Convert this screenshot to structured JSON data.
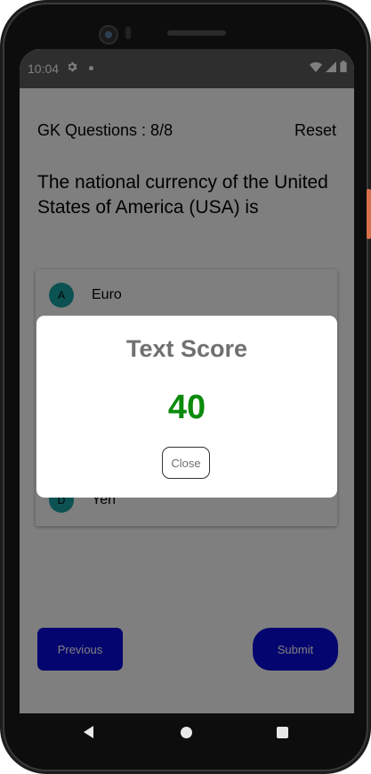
{
  "status_bar": {
    "time": "10:04",
    "icons": [
      "gear-icon",
      "notification-dot-icon",
      "wifi-icon",
      "cellular-signal-icon",
      "battery-icon"
    ]
  },
  "quiz": {
    "counter": "GK Questions : 8/8",
    "reset_label": "Reset",
    "question": "The national currency of the United States of America (USA) is",
    "options": [
      {
        "letter": "A",
        "label": "Euro"
      },
      {
        "letter": "D",
        "label": "Yen"
      }
    ],
    "previous_label": "Previous",
    "submit_label": "Submit"
  },
  "dialog": {
    "title": "Text Score",
    "score": "40",
    "close_label": "Close"
  },
  "colors": {
    "primary_button": "#0a0adf",
    "option_badge": "#1aa5a5",
    "score_text": "#0a8a0a",
    "dialog_title": "#707070"
  }
}
